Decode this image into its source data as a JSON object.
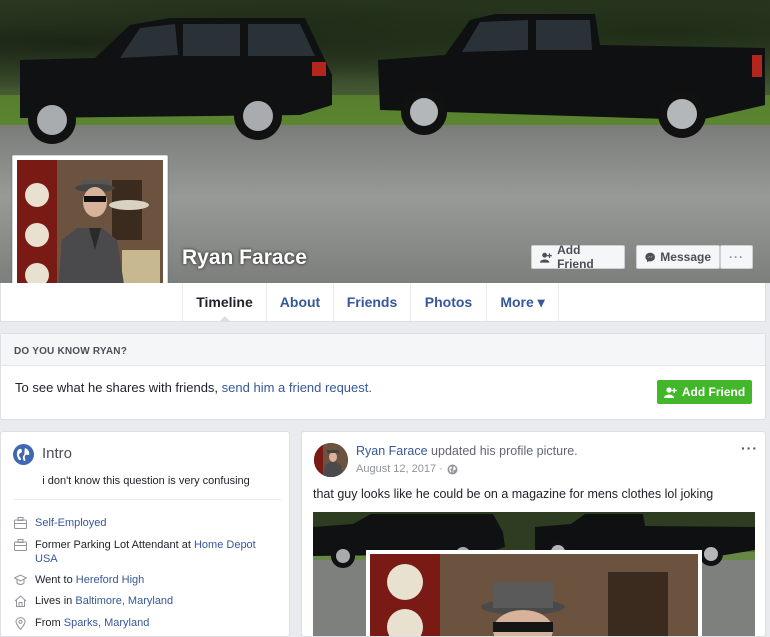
{
  "profile": {
    "name": "Ryan Farace",
    "add_friend_label": "Add Friend",
    "message_label": "Message",
    "more_dots": "···"
  },
  "nav": {
    "tabs": [
      {
        "label": "Timeline"
      },
      {
        "label": "About"
      },
      {
        "label": "Friends"
      },
      {
        "label": "Photos"
      },
      {
        "label": "More ▾"
      }
    ]
  },
  "know": {
    "header": "DO YOU KNOW RYAN?",
    "body_prefix": "To see what he shares with friends, ",
    "body_link": "send him a friend request.",
    "button_label": "Add Friend"
  },
  "intro": {
    "title": "Intro",
    "bio": "i don't know this question is very confusing",
    "items": [
      {
        "icon": "briefcase-icon",
        "text": "",
        "link": "Self-Employed",
        "text_after": ""
      },
      {
        "icon": "briefcase-icon",
        "text": "Former Parking Lot Attendant at ",
        "link": "Home Depot USA",
        "text_after": ""
      },
      {
        "icon": "graduation-cap-icon",
        "text": "Went to ",
        "link": "Hereford High",
        "text_after": ""
      },
      {
        "icon": "home-icon",
        "text": "Lives in ",
        "link": "Baltimore, Maryland",
        "text_after": ""
      },
      {
        "icon": "map-pin-icon",
        "text": "From ",
        "link": "Sparks, Maryland",
        "text_after": ""
      }
    ]
  },
  "post": {
    "author": "Ryan Farace",
    "action": " updated his profile picture.",
    "date": "August 12, 2017 ·",
    "menu": "···",
    "text": "that guy looks like he could be on a magazine for mens clothes lol joking"
  },
  "colors": {
    "link": "#365899",
    "green_button": "#42b72a",
    "page_bg": "#e9ebee"
  }
}
